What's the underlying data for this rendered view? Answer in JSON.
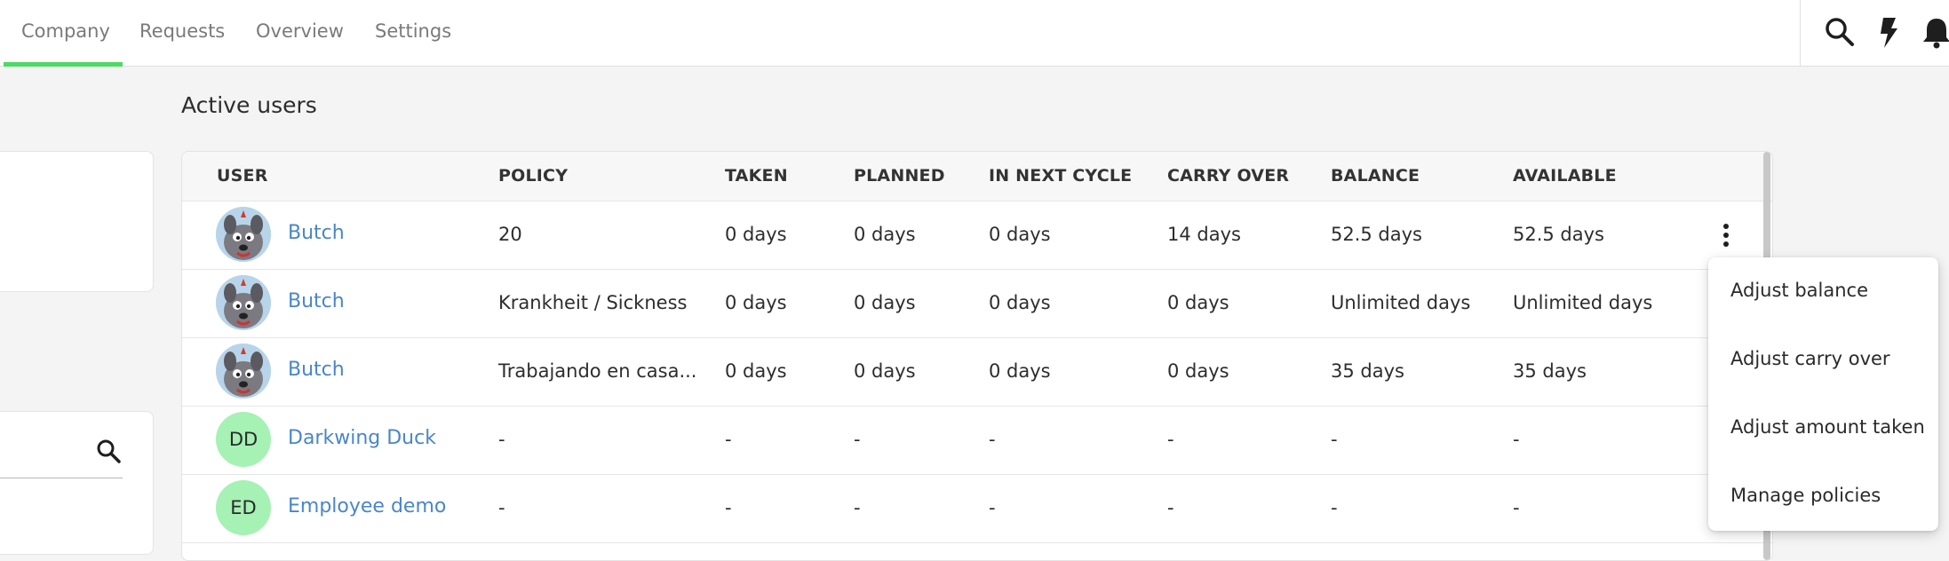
{
  "nav": {
    "tabs": [
      {
        "label": "Company",
        "active": true
      },
      {
        "label": "Requests"
      },
      {
        "label": "Overview"
      },
      {
        "label": "Settings"
      }
    ],
    "accent_color": "#4cd964",
    "icons": [
      "search-icon",
      "lightning-icon",
      "bell-icon"
    ]
  },
  "section_title": "Active users",
  "table": {
    "columns": [
      "USER",
      "POLICY",
      "TAKEN",
      "PLANNED",
      "IN NEXT CYCLE",
      "CARRY OVER",
      "BALANCE",
      "AVAILABLE"
    ],
    "rows": [
      {
        "user": "Butch",
        "avatar": "cartoon-dog",
        "policy": "20",
        "taken": "0 days",
        "planned": "0 days",
        "next_cycle": "0 days",
        "carry_over": "14 days",
        "balance": "52.5 days",
        "available": "52.5 days"
      },
      {
        "user": "Butch",
        "avatar": "cartoon-dog",
        "policy": "Krankheit / Sickness",
        "taken": "0 days",
        "planned": "0 days",
        "next_cycle": "0 days",
        "carry_over": "0 days",
        "balance": "Unlimited days",
        "available": "Unlimited days"
      },
      {
        "user": "Butch",
        "avatar": "cartoon-dog",
        "policy": "Trabajando en casa...",
        "taken": "0 days",
        "planned": "0 days",
        "next_cycle": "0 days",
        "carry_over": "0 days",
        "balance": "35 days",
        "available": "35 days"
      },
      {
        "user": "Darkwing Duck",
        "initials": "DD",
        "policy": "-",
        "taken": "-",
        "planned": "-",
        "next_cycle": "-",
        "carry_over": "-",
        "balance": "-",
        "available": "-"
      },
      {
        "user": "Employee demo",
        "initials": "ED",
        "policy": "-",
        "taken": "-",
        "planned": "-",
        "next_cycle": "-",
        "carry_over": "-",
        "balance": "-",
        "available": "-"
      }
    ]
  },
  "dropdown": {
    "items": [
      "Adjust balance",
      "Adjust carry over",
      "Adjust amount taken",
      "Manage policies"
    ]
  },
  "colors": {
    "link": "#4a86c8",
    "initials_avatar_bg": "#a6f1b4"
  }
}
